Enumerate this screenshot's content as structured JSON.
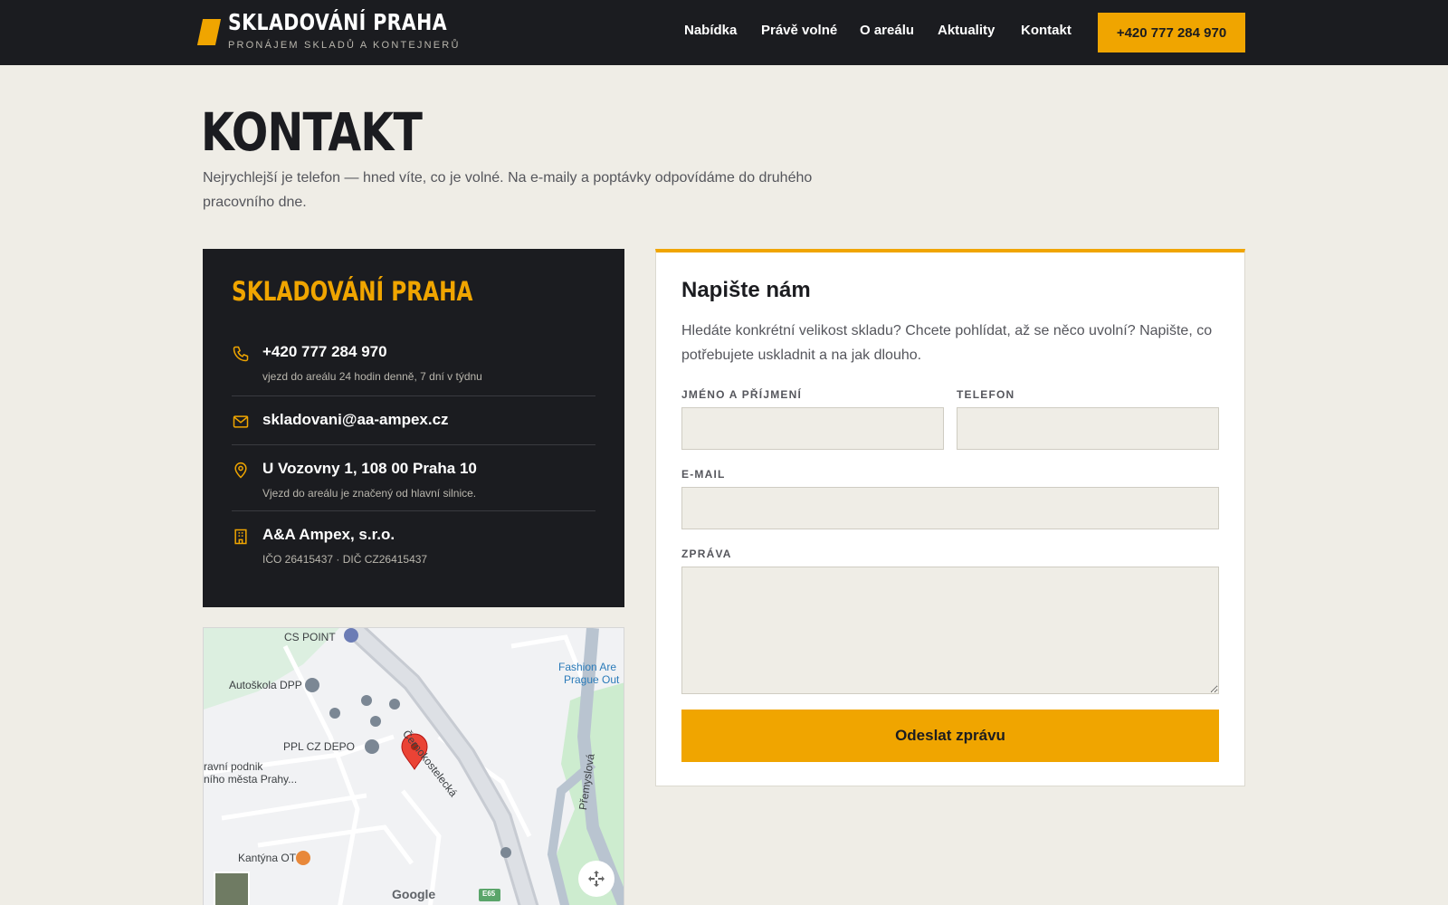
{
  "header": {
    "brand_title": "SKLADOVÁNÍ PRAHA",
    "brand_subtitle": "PRONÁJEM SKLADŮ A KONTEJNERŮ",
    "nav": [
      "Nabídka",
      "Právě volné",
      "O areálu",
      "Aktuality",
      "Kontakt"
    ],
    "cta_phone": "+420 777 284 970"
  },
  "page": {
    "title": "KONTAKT",
    "lead": "Nejrychlejší je telefon — hned víte, co je volné. Na e-maily a poptávky odpovídáme do druhého pracovního dne."
  },
  "contact_card": {
    "title": "SKLADOVÁNÍ PRAHA",
    "phone": "+420 777 284 970",
    "phone_note": "vjezd do areálu 24 hodin denně, 7 dní v týdnu",
    "email": "skladovani@aa-ampex.cz",
    "address": "U Vozovny 1, 108 00 Praha 10",
    "address_note": "Vjezd do areálu je značený od hlavní silnice.",
    "company": "A&A Ampex, s.r.o.",
    "company_ids": "IČO 26415437 · DIČ CZ26415437"
  },
  "map": {
    "labels": {
      "cs_point": "CS POINT",
      "autoskola": "Autoškola DPP",
      "ppl": "PPL CZ DEPO",
      "podnik_1": "ravní podnik",
      "podnik_2": "ního města Prahy...",
      "kantyna": "Kantýna OT",
      "fashion_1": "Fashion Are",
      "fashion_2": "Prague Out",
      "street_1": "Černokostelecká",
      "street_2": "Přemyslová",
      "road_badge": "E65",
      "google": "Google"
    }
  },
  "form": {
    "title": "Napište nám",
    "intro": "Hledáte konkrétní velikost skladu? Chcete pohlídat, až se něco uvolní? Napište, co potřebujete uskladnit a na jak dlouho.",
    "name_label": "JMÉNO A PŘÍJMENÍ",
    "phone_label": "TELEFON",
    "email_label": "E-MAIL",
    "message_label": "ZPRÁVA",
    "submit_label": "Odeslat zprávu"
  },
  "colors": {
    "accent": "#f0a500",
    "dark": "#1b1c20",
    "background": "#efede6"
  }
}
